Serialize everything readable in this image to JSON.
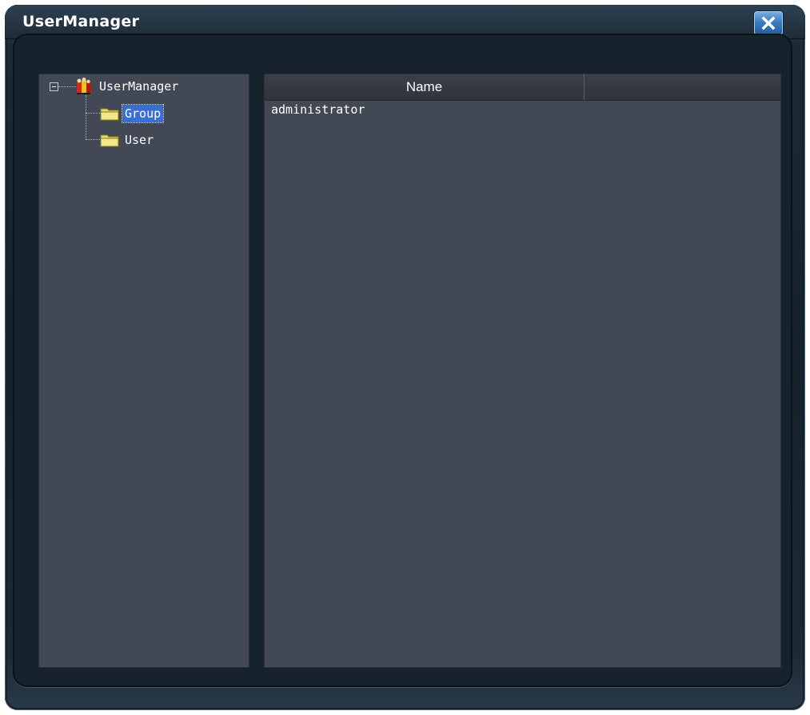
{
  "window": {
    "title": "UserManager",
    "close_icon": "close-x-icon"
  },
  "tree": {
    "root": {
      "label": "UserManager",
      "icon": "users-manager-icon",
      "expanded": true,
      "children": [
        {
          "label": "Group",
          "icon": "folder-icon",
          "selected": true
        },
        {
          "label": "User",
          "icon": "folder-icon",
          "selected": false
        }
      ]
    }
  },
  "list": {
    "columns": [
      "Name",
      ""
    ],
    "rows": [
      {
        "name": "administrator"
      }
    ]
  },
  "colors": {
    "pane_bg": "#424854",
    "selection": "#3a6fd0",
    "folder": "#e8dc6a",
    "close_button": "#3b7cc0"
  }
}
